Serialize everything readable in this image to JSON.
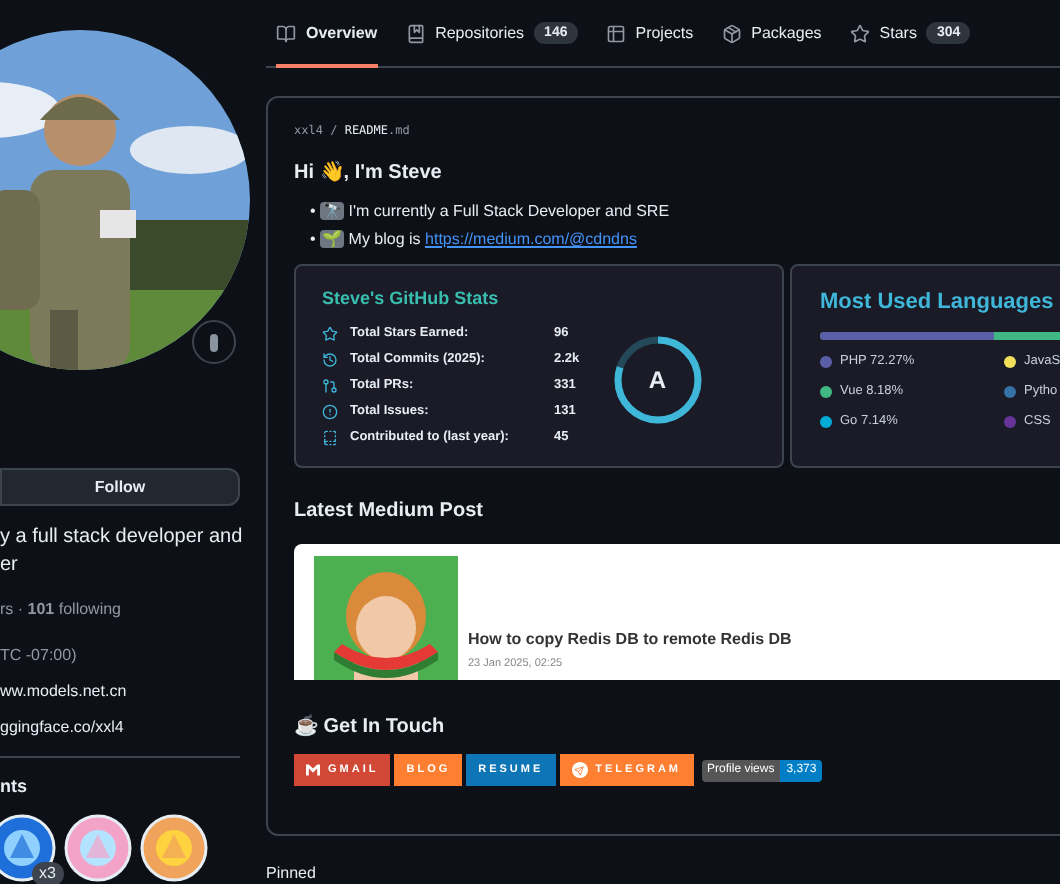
{
  "sidebar": {
    "avatar": {
      "kind": "picture"
    },
    "follow_button": "Follow",
    "bio_lines": [
      "y a full stack developer and",
      "er"
    ],
    "followers": "rs · **101** following",
    "details": [
      "TC -07:00)",
      "ww.models.net.cn",
      "ggingface.co/xxl4"
    ],
    "achievements_heading": "nts",
    "achievements": [
      {
        "kind": "blue",
        "count": "x3"
      },
      {
        "kind": "pink"
      },
      {
        "kind": "yellow"
      }
    ]
  },
  "tabs": [
    {
      "label": "Overview",
      "kind": "book",
      "selected": true
    },
    {
      "label": "Repositories",
      "kind": "repo",
      "count": "146",
      "selected": false
    },
    {
      "label": "Projects",
      "kind": "table",
      "selected": false
    },
    {
      "label": "Packages",
      "kind": "package",
      "selected": false
    },
    {
      "label": "Stars",
      "kind": "star",
      "count": "304",
      "selected": false
    }
  ],
  "readme": {
    "owner": "xxl4",
    "separator": "/",
    "file": "README",
    "ext": ".md",
    "greeting": "Hi 👋,  I'm Steve",
    "bullets": [
      {
        "marker": "•",
        "emoji": "🔭",
        "text": "I'm currently a Full Stack Developer and SRE"
      },
      {
        "marker": "•",
        "emoji": "🌱",
        "text": "My blog is ",
        "link": "https://medium.com/@cdndns"
      }
    ],
    "stats": {
      "title": "Steve's GitHub Stats",
      "grade": "A",
      "level": 0.8,
      "rows": [
        {
          "kind": "star",
          "label": "Total Stars Earned:",
          "value": "96"
        },
        {
          "kind": "history",
          "label": "Total Commits (2025):",
          "value": "2.2k"
        },
        {
          "kind": "pr",
          "label": "Total PRs:",
          "value": "331"
        },
        {
          "kind": "issue",
          "label": "Total Issues:",
          "value": "131"
        },
        {
          "kind": "repo",
          "label": "Contributed to (last year):",
          "value": "45"
        }
      ]
    },
    "languages": {
      "title": "Most Used Languages",
      "items": [
        {
          "name": "PHP 72.27%",
          "color": "#5b5fa8",
          "level": 0.7227
        },
        {
          "name": "JavaS",
          "color": "#f1e05a"
        },
        {
          "name": "Vue 8.18%",
          "color": "#41b883"
        },
        {
          "name": "Pytho",
          "color": "#3572a5"
        },
        {
          "name": "Go 7.14%",
          "color": "#00add8"
        },
        {
          "name": "CSS",
          "color": "#663399"
        }
      ]
    },
    "medium_heading": "Latest Medium Post",
    "post": {
      "image": {
        "kind": "picture"
      },
      "title": "How to copy Redis DB to remote Redis DB",
      "date": "23 Jan 2025, 02:25"
    },
    "contact_heading": "☕ Get In Touch",
    "badges": [
      {
        "kind": "gmail",
        "label": "GMAIL",
        "color": "#d14836"
      },
      {
        "kind": "plain",
        "label": "BLOG",
        "color": "#ff7f32"
      },
      {
        "kind": "plain",
        "label": "RESUME",
        "color": "#0e75b6"
      },
      {
        "kind": "telegram",
        "label": "TELEGRAM",
        "color": "#ff7f32"
      }
    ],
    "views": {
      "label": "Profile views",
      "count": "3,373"
    }
  },
  "pinned_heading": "Pinned"
}
